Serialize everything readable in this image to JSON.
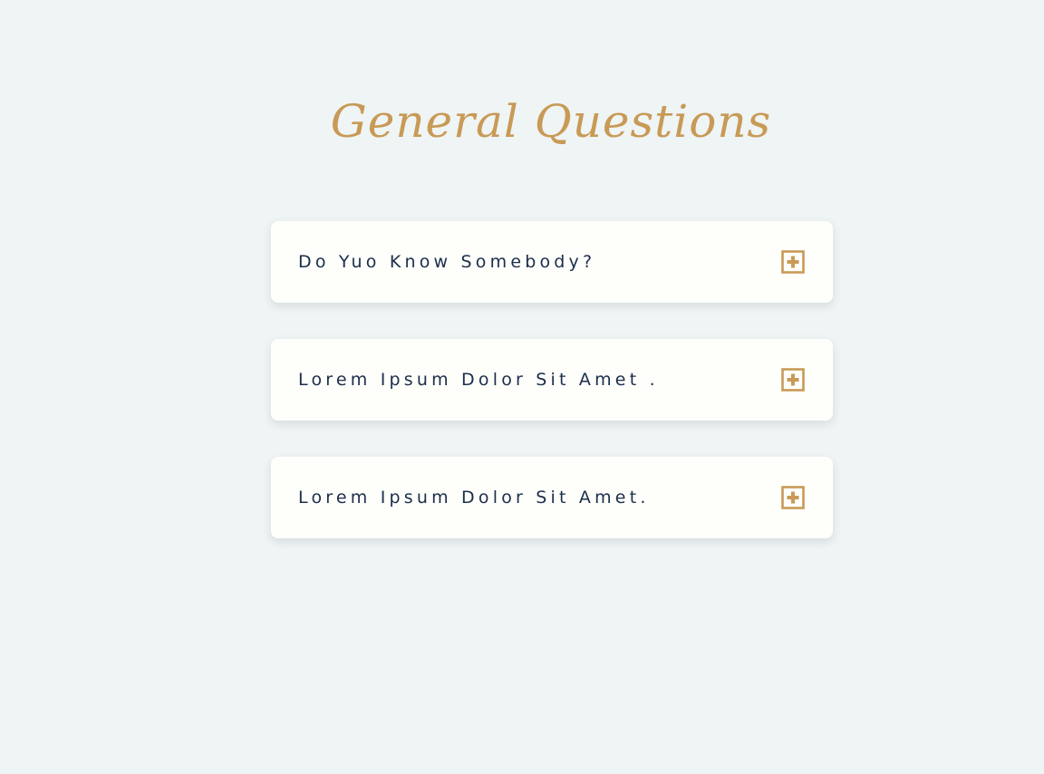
{
  "page": {
    "title": "General Questions"
  },
  "faq": {
    "items": [
      {
        "question": "Do Yuo Know Somebody?",
        "icon": "plus-square-icon"
      },
      {
        "question": "Lorem Ipsum Dolor Sit Amet .",
        "icon": "plus-square-icon"
      },
      {
        "question": "Lorem Ipsum Dolor Sit Amet.",
        "icon": "plus-square-icon"
      }
    ]
  },
  "colors": {
    "background": "#eff4f5",
    "card": "#fefefb",
    "accent": "#c89a56",
    "text": "#1b2e4a"
  }
}
